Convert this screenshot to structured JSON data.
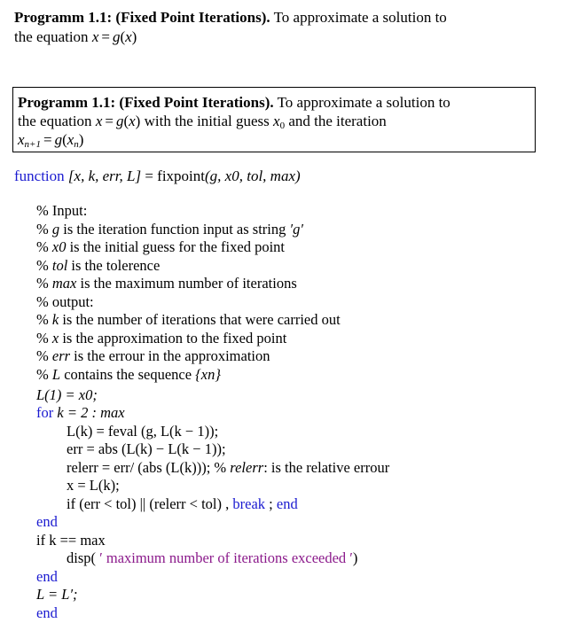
{
  "plain_block": {
    "heading": "Programm 1.1: (Fixed Point Iterations).",
    "text_line1": "To approximate a solution to",
    "text_line2_prefix": "the equation ",
    "eq_lhs": "x",
    "eq_op": "=",
    "eq_rhs_fn": "g",
    "eq_rhs_arg": "x"
  },
  "boxed_block": {
    "heading": "Programm 1.1: (Fixed Point Iterations).",
    "text_line1": "To approximate a solution to",
    "text_line2_prefix": "the equation ",
    "text_line2_mid": " with the initial guess ",
    "text_line2_suffix": " and the iteration",
    "x0_var": "x",
    "x0_sub": "0",
    "iter_lhs_var": "x",
    "iter_lhs_sub": "n+1",
    "iter_rhs_fn": "g",
    "iter_rhs_var": "x",
    "iter_rhs_sub": "n"
  },
  "code": {
    "signature": {
      "keyword": "function",
      "outputs": "[x, k, err, L]",
      "equals": "=",
      "name": "fixpoint",
      "args": "(g, x0, tol, max)"
    },
    "comments": [
      {
        "pct": "%",
        "var": "",
        "text": " Input:"
      },
      {
        "pct": "%",
        "var": "g",
        "text": " is the iteration function input as string ",
        "tail": "′g′"
      },
      {
        "pct": "%",
        "var": "x0",
        "text": " is the initial guess for the fixed point"
      },
      {
        "pct": "%",
        "var": "tol",
        "text": " is the tolerence"
      },
      {
        "pct": "%",
        "var": "max",
        "text": " is the maximum number of iterations"
      },
      {
        "pct": "%",
        "var": "",
        "text": " output:"
      },
      {
        "pct": "%",
        "var": "k",
        "text": " is the number of iterations that were carried out"
      },
      {
        "pct": "%",
        "var": "x",
        "text": " is the approximation to the fixed point"
      },
      {
        "pct": "%",
        "var": "err",
        "text": " is the errour in the approximation"
      },
      {
        "pct": "%",
        "var": "L",
        "text": " contains the sequence ",
        "tail": "{xn}"
      }
    ],
    "init_line": "L(1) = x0;",
    "for_keyword": "for",
    "for_range": "k = 2 : max",
    "body": {
      "line1": "L(k) = feval (g, L(k − 1));",
      "line2": "err = abs (L(k) − L(k − 1));",
      "line3_code": "relerr = err/ (abs (L(k)));",
      "line3_comment_pct": "%",
      "line3_comment_var": "relerr",
      "line3_comment_text": ": is the relative errour",
      "line4": "x = L(k);",
      "line5_cond": "if (err < tol) || (relerr < tol) ,",
      "line5_break": "break",
      "line5_sep": ";",
      "line5_end": "end"
    },
    "end_for": "end",
    "if_line": "if k == max",
    "disp_prefix": "disp(",
    "disp_string": " ′ maximum number of iterations exceeded ′",
    "disp_suffix": ")",
    "end_if": "end",
    "transpose_line": "L = L′;",
    "end_function": "end"
  },
  "colors": {
    "keyword": "#1a1ad0",
    "string": "#8b1a8b",
    "text": "#000000"
  }
}
